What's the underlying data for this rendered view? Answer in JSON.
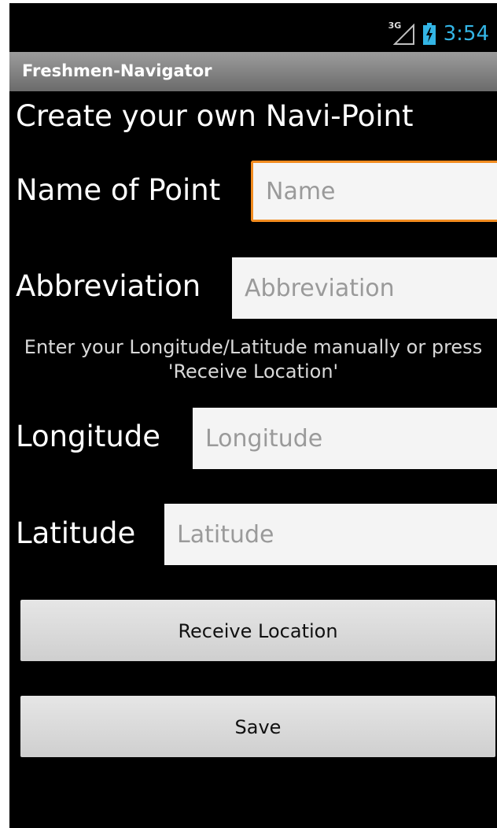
{
  "status_bar": {
    "network_tag": "3G",
    "network_icon": "signal-icon",
    "battery_icon": "battery-charging-icon",
    "time": "3:54",
    "time_color": "#33b5e5"
  },
  "app": {
    "title": "Freshmen-Navigator"
  },
  "form": {
    "heading": "Create your own Navi-Point",
    "name": {
      "label": "Name of Point",
      "placeholder": "Name",
      "value": ""
    },
    "abbreviation": {
      "label": "Abbreviation",
      "placeholder": "Abbreviation",
      "value": ""
    },
    "hint": "Enter your Longitude/Latitude manually or press 'Receive Location'",
    "longitude": {
      "label": "Longitude",
      "placeholder": "Longitude",
      "value": ""
    },
    "latitude": {
      "label": "Latitude",
      "placeholder": "Latitude",
      "value": ""
    },
    "receive_location_label": "Receive Location",
    "save_label": "Save"
  },
  "colors": {
    "focus_border": "#f18b1f",
    "background": "#000000"
  }
}
